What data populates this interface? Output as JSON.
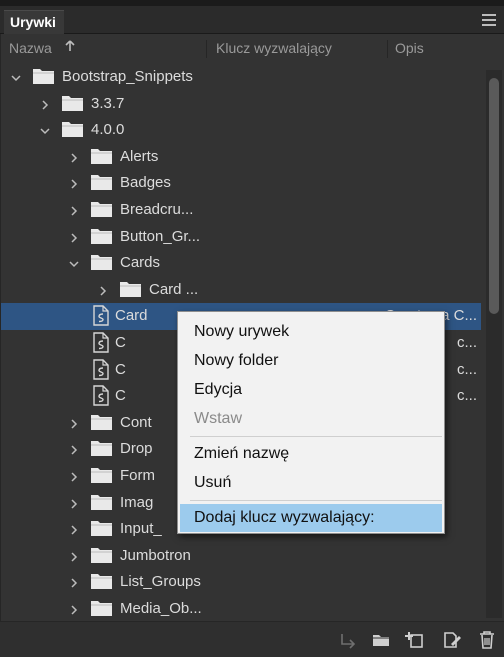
{
  "panel": {
    "tab_label": "Urywki"
  },
  "columns": {
    "name": "Nazwa",
    "trigger": "Klucz wyzwalający",
    "desc": "Opis"
  },
  "tree": [
    {
      "label": "Bootstrap_Snippets",
      "depth": 0,
      "type": "folder",
      "expanded": true
    },
    {
      "label": "3.3.7",
      "depth": 1,
      "type": "folder",
      "expanded": false
    },
    {
      "label": "4.0.0",
      "depth": 1,
      "type": "folder",
      "expanded": true
    },
    {
      "label": "Alerts",
      "depth": 2,
      "type": "folder",
      "expanded": false
    },
    {
      "label": "Badges",
      "depth": 2,
      "type": "folder",
      "expanded": false
    },
    {
      "label": "Breadcru...",
      "depth": 2,
      "type": "folder",
      "expanded": false
    },
    {
      "label": "Button_Gr...",
      "depth": 2,
      "type": "folder",
      "expanded": false
    },
    {
      "label": "Cards",
      "depth": 2,
      "type": "folder",
      "expanded": true
    },
    {
      "label": "Card ...",
      "depth": 3,
      "type": "folder",
      "expanded": false
    },
    {
      "label": "Card",
      "depth": 3,
      "type": "file",
      "selected": true,
      "extra": "Creates a C..."
    },
    {
      "label": "C",
      "depth": 3,
      "type": "file",
      "extra": "c..."
    },
    {
      "label": "C",
      "depth": 3,
      "type": "file",
      "extra": "c..."
    },
    {
      "label": "C",
      "depth": 3,
      "type": "file",
      "extra": "c..."
    },
    {
      "label": "Cont",
      "depth": 2,
      "type": "folder",
      "expanded": false
    },
    {
      "label": "Drop",
      "depth": 2,
      "type": "folder",
      "expanded": false
    },
    {
      "label": "Form",
      "depth": 2,
      "type": "folder",
      "expanded": false
    },
    {
      "label": "Imag",
      "depth": 2,
      "type": "folder",
      "expanded": false
    },
    {
      "label": "Input_",
      "depth": 2,
      "type": "folder",
      "expanded": false
    },
    {
      "label": "Jumbotron",
      "depth": 2,
      "type": "folder",
      "expanded": false
    },
    {
      "label": "List_Groups",
      "depth": 2,
      "type": "folder",
      "expanded": false
    },
    {
      "label": "Media_Ob...",
      "depth": 2,
      "type": "folder",
      "expanded": false
    }
  ],
  "context_menu": {
    "new_snippet": "Nowy urywek",
    "new_folder": "Nowy folder",
    "edit": "Edycja",
    "insert": "Wstaw",
    "rename": "Zmień nazwę",
    "delete": "Usuń",
    "add_trigger": "Dodaj klucz wyzwalający:"
  },
  "icons": {
    "bottom": [
      "insert-arrow-icon",
      "new-folder-icon",
      "new-snippet-icon",
      "edit-snippet-icon",
      "trash-icon"
    ]
  },
  "colors": {
    "selection": "#2e5584",
    "menu_highlight": "#9ccbed"
  }
}
